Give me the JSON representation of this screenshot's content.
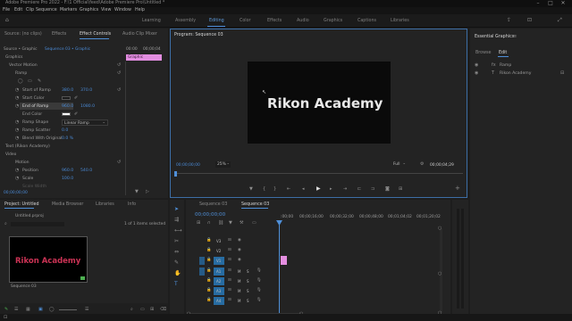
{
  "title": "Adobe Premiere Pro 2022 - F:\\1 Official\\feed\\Adobe Premiere Pro\\Untitled *",
  "window_controls": {
    "minimize": "–",
    "maximize": "□",
    "close": "✕"
  },
  "menu": [
    "File",
    "Edit",
    "Clip",
    "Sequence",
    "Markers",
    "Graphics",
    "View",
    "Window",
    "Help"
  ],
  "workspaces": [
    "Learning",
    "Assembly",
    "Editing",
    "Color",
    "Effects",
    "Audio",
    "Graphics",
    "Captions",
    "Libraries"
  ],
  "active_workspace": "Editing",
  "source_tabs": [
    "Source: (no clips)",
    "Effects",
    "Effect Controls",
    "Audio Clip Mixer"
  ],
  "ec": {
    "crumbs": "Source • Graphic",
    "seq_crumb": "Sequence 03 • Graphic",
    "time1": "00:00",
    "time2": "00;00;04",
    "clip_label": "Graphic",
    "section": "Graphics",
    "vector_motion": "Vector Motion",
    "ramp": "Ramp",
    "start_of_ramp": "Start of Ramp",
    "start_x": "380.0",
    "start_y": "370.0",
    "start_color": "Start Color",
    "end_of_ramp": "End of Ramp",
    "end_x": "960.0",
    "end_y": "1080.0",
    "end_color": "End Color",
    "ramp_shape": "Ramp Shape",
    "ramp_shape_val": "Linear Ramp",
    "ramp_scatter": "Ramp Scatter",
    "ramp_scatter_val": "0.0",
    "blend": "Blend With Original",
    "blend_val": "0.0 %",
    "text_layer": "Text (Rikon Academy)",
    "video": "Video",
    "motion": "Motion",
    "position": "Position",
    "pos_x": "960.0",
    "pos_y": "540.0",
    "scale": "Scale",
    "scale_val": "100.0",
    "scale_width": "Scale Width",
    "timecode": "00;00;00;00"
  },
  "program": {
    "tab": "Program: Sequence 03",
    "overlay_text": "Rikon Academy",
    "timecode": "00;00;00;00",
    "zoom": "25%",
    "quality": "Full",
    "duration": "00;00;04;29"
  },
  "essential": {
    "title": "Essential Graphics",
    "tabs": [
      "Browse",
      "Edit"
    ],
    "layers": [
      "Ramp",
      "Rikon Academy"
    ]
  },
  "project": {
    "tabs": [
      "Project: Untitled",
      "Media Browser",
      "Libraries",
      "Info"
    ],
    "file": "Untitled.prproj",
    "count": "1 of 1 items selected",
    "thumb_text": "Rikon Academy",
    "item": "Sequence 03"
  },
  "timeline": {
    "tabs": [
      "Sequence 03",
      "Sequence 03"
    ],
    "timecode": "00;00;00;00",
    "ruler": [
      ":00;00",
      "00;00;16;00",
      "00;00;32;00",
      "00;00;48;00",
      "00;01;04;02",
      "00;01;20;02"
    ],
    "video_tracks": [
      "V3",
      "V2",
      "V1"
    ],
    "audio_tracks": [
      "A1",
      "A2",
      "A3",
      "A4"
    ]
  },
  "colors": {
    "accent": "#2b8ae0",
    "clip": "#e48ee0",
    "panel": "#232323"
  }
}
